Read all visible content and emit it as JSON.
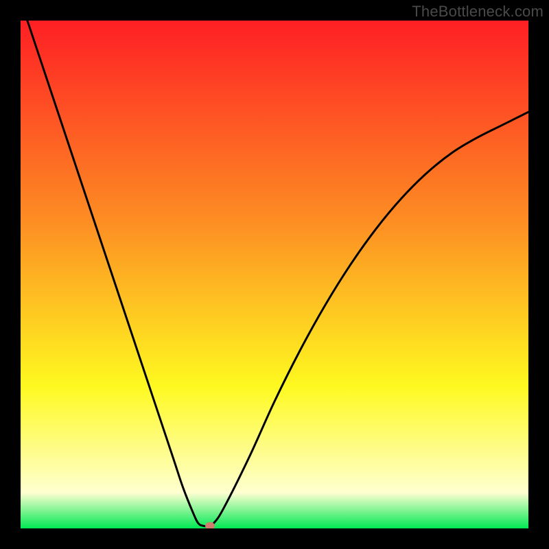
{
  "watermark": "TheBottleneck.com",
  "chart_data": {
    "type": "line",
    "title": "",
    "xlabel": "",
    "ylabel": "",
    "xlim": [
      0,
      100
    ],
    "ylim": [
      0,
      100
    ],
    "grid": false,
    "legend": false,
    "series": [
      {
        "name": "curve",
        "x": [
          0,
          5,
          10,
          15,
          20,
          25,
          30,
          32,
          34,
          35,
          36,
          37,
          38,
          40,
          45,
          50,
          55,
          60,
          65,
          70,
          75,
          80,
          85,
          90,
          95,
          100
        ],
        "y": [
          104,
          89,
          74,
          59,
          44,
          29,
          14,
          8,
          3,
          1,
          0.5,
          0.5,
          1,
          4,
          14,
          25,
          35,
          44,
          52,
          59,
          65,
          70,
          74,
          77,
          79.5,
          82
        ]
      }
    ],
    "marker": {
      "x": 37.3,
      "y": 0.5
    },
    "gradient_bg": {
      "top": "#fe1f24",
      "mid1": "#fd8f23",
      "mid2": "#fef920",
      "near_bottom": "#feffd0",
      "bottom": "#00e853"
    }
  }
}
